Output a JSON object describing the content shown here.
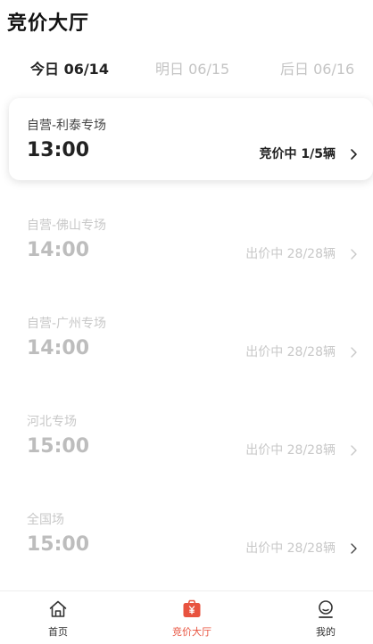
{
  "header": {
    "title": "竞价大厅"
  },
  "date_tabs": [
    {
      "label": "今日 06/14",
      "active": true
    },
    {
      "label": "明日 06/15",
      "active": false
    },
    {
      "label": "后日 06/16",
      "active": false
    }
  ],
  "sessions": [
    {
      "name": "自营-利泰专场",
      "time": "13:00",
      "status": "竞价中 1/5辆",
      "active": true
    },
    {
      "name": "自营-佛山专场",
      "time": "14:00",
      "status": "出价中 28/28辆",
      "active": false
    },
    {
      "name": "自营-广州专场",
      "time": "14:00",
      "status": "出价中 28/28辆",
      "active": false
    },
    {
      "name": "河北专场",
      "time": "15:00",
      "status": "出价中 28/28辆",
      "active": false
    },
    {
      "name": "全国场",
      "time": "15:00",
      "status": "出价中 28/28辆",
      "active": false
    }
  ],
  "tabbar": [
    {
      "label": "首页",
      "icon": "home-icon",
      "active": false
    },
    {
      "label": "竞价大厅",
      "icon": "auction-bag-icon",
      "active": true
    },
    {
      "label": "我的",
      "icon": "profile-icon",
      "active": false
    }
  ],
  "colors": {
    "accent": "#e8533f",
    "text": "#222222",
    "muted": "#c8c8c8"
  }
}
